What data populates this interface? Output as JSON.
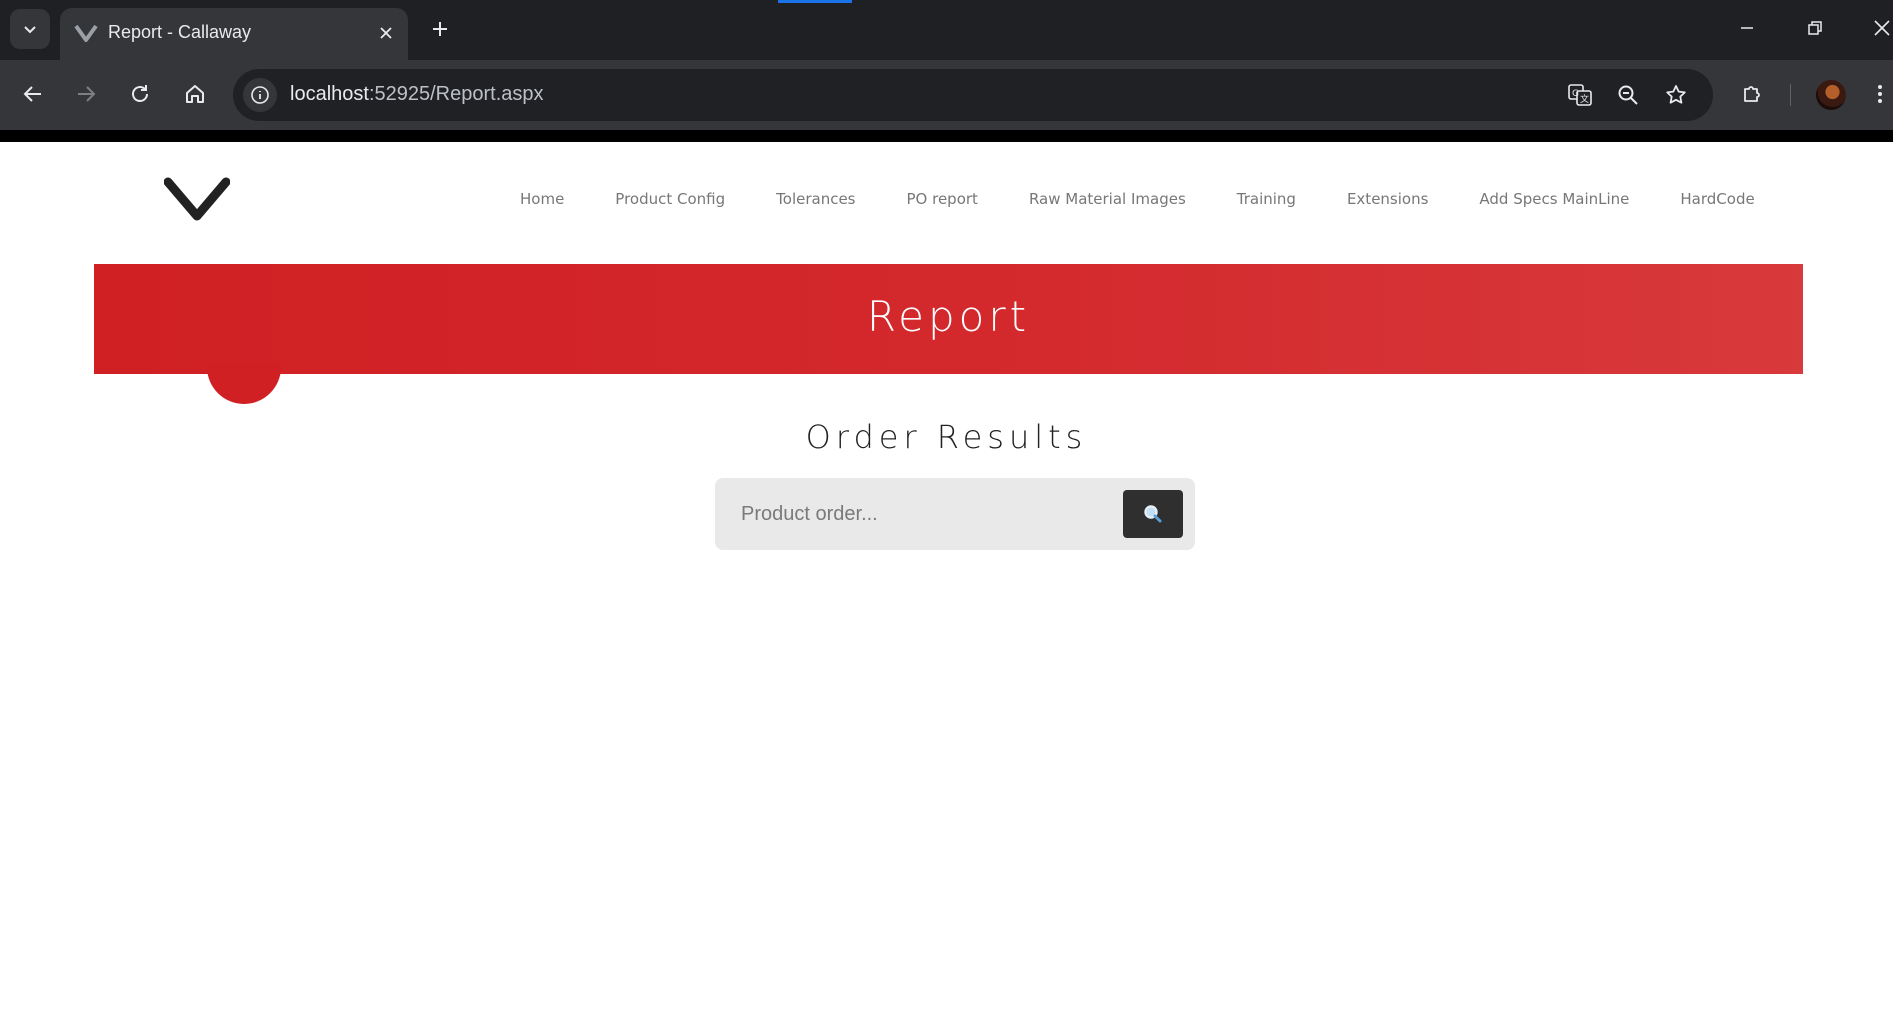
{
  "browser": {
    "tab_title": "Report - Callaway",
    "url_host": "localhost",
    "url_rest": ":52925/Report.aspx",
    "accent_color": "#1a73e8"
  },
  "site": {
    "logo_icon": "chevron-logo-icon",
    "nav": [
      {
        "label": "Home"
      },
      {
        "label": "Product Config"
      },
      {
        "label": "Tolerances"
      },
      {
        "label": "PO report"
      },
      {
        "label": "Raw Material Images"
      },
      {
        "label": "Training"
      },
      {
        "label": "Extensions"
      },
      {
        "label": "Add Specs MainLine"
      },
      {
        "label": "HardCode"
      }
    ]
  },
  "banner": {
    "title": "Report",
    "color": "#d02024"
  },
  "main": {
    "section_title": "Order Results",
    "search": {
      "placeholder": "Product order...",
      "value": "",
      "button_icon": "search-icon"
    }
  }
}
